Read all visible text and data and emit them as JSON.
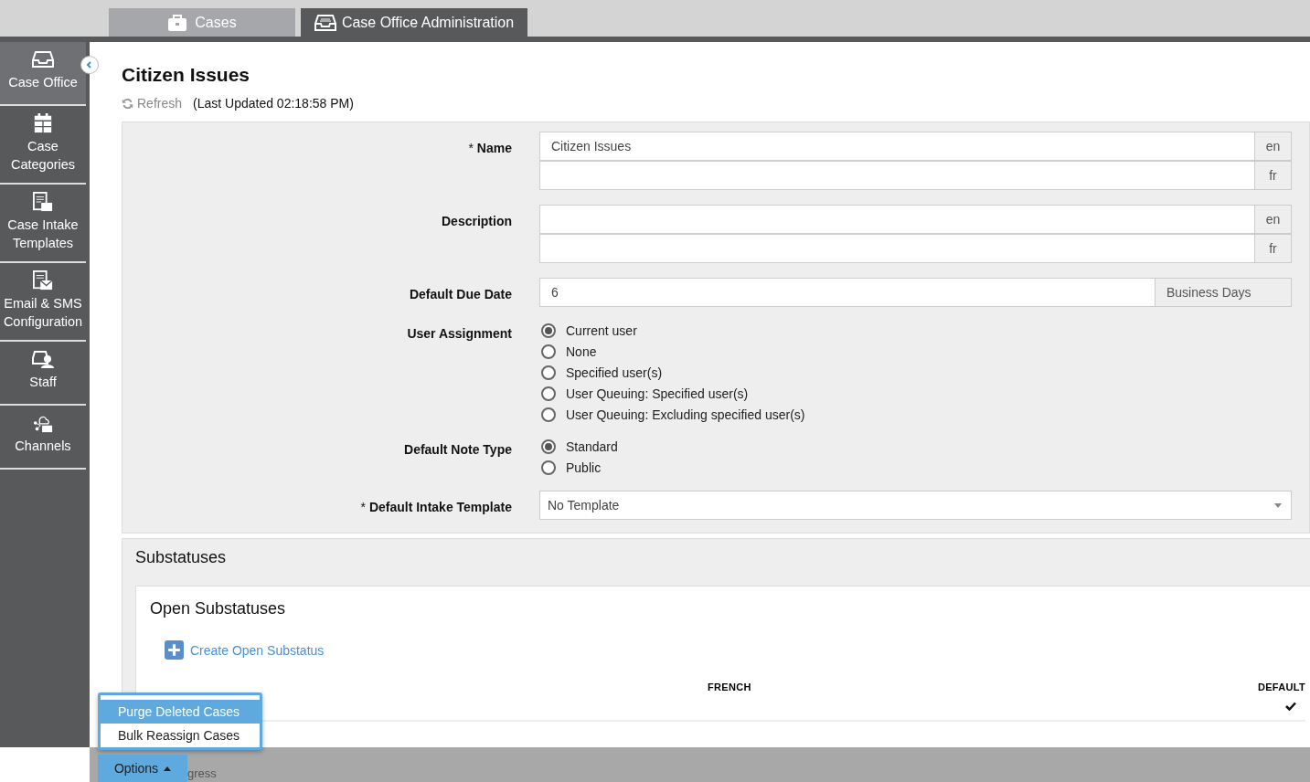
{
  "tabs": [
    {
      "label": "Cases",
      "selected": false
    },
    {
      "label": "Case Office Administration",
      "selected": true
    }
  ],
  "sidebar": {
    "items": [
      {
        "label": "Case Office",
        "selected": true
      },
      {
        "label": "Case Categories",
        "selected": false
      },
      {
        "label": "Case Intake Templates",
        "selected": false
      },
      {
        "label": "Email & SMS Configuration",
        "selected": false
      },
      {
        "label": "Staff",
        "selected": false
      },
      {
        "label": "Channels",
        "selected": false
      }
    ]
  },
  "page": {
    "title": "Citizen Issues",
    "refresh": "Refresh",
    "last_updated": "(Last Updated 02:18:58 PM)"
  },
  "form": [
    {
      "kind": "lang",
      "label": "Name",
      "required_mark": "*",
      "fields": [
        {
          "value": "Citizen Issues",
          "lang": "en"
        },
        {
          "lang": "fr"
        }
      ]
    },
    {
      "kind": "lang",
      "label": "Description",
      "fields": [
        {
          "lang": "en"
        },
        {
          "lang": "fr"
        }
      ]
    },
    {
      "kind": "addon",
      "label": "Default Due Date",
      "value": "6",
      "addon": "Business Days"
    },
    {
      "kind": "radio",
      "label": "User Assignment",
      "options": [
        {
          "label": "Current user",
          "selected": true
        },
        {
          "label": "None",
          "selected": false
        },
        {
          "label": "Specified user(s)",
          "selected": false
        },
        {
          "label": "User Queuing: Specified user(s)",
          "selected": false
        },
        {
          "label": "User Queuing: Excluding specified user(s)",
          "selected": false
        }
      ]
    },
    {
      "kind": "radio",
      "label": "Default Note Type",
      "options": [
        {
          "label": "Standard",
          "selected": true
        },
        {
          "label": "Public",
          "selected": false
        }
      ]
    },
    {
      "kind": "select",
      "label": "Default Intake Template",
      "required_mark": "*",
      "value": "No Template"
    }
  ],
  "substatuses": {
    "title": "Substatuses",
    "open": {
      "title": "Open Substatuses",
      "create": "Create Open Substatus",
      "columns": [
        "FRENCH",
        "DEFAULT"
      ],
      "rows": [
        {
          "default": true
        }
      ]
    }
  },
  "options_menu": {
    "items": [
      {
        "label": "Purge Deleted Cases",
        "selected": true
      },
      {
        "label": "Bulk Reassign Cases",
        "selected": false
      }
    ],
    "button": "Options"
  },
  "status_bar": {
    "text": "gress"
  }
}
